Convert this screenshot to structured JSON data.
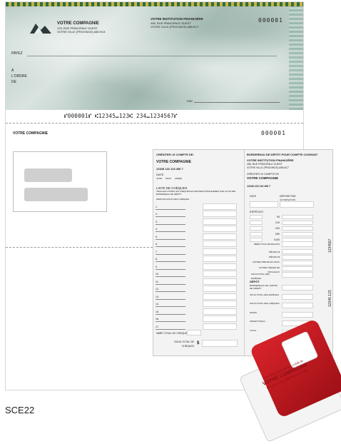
{
  "cheque": {
    "company": "VOTRE COMPAGNIE",
    "address_1": "123, RUE PRINCIPALE OUEST",
    "address_2": "VOTRE VILLE (PROVINCE) A5B 9C8",
    "institution": "VOTRE INSTITUTION FINANCIÈRE",
    "institution_addr_1": "456, RUE PRINCIPALE OUEST",
    "institution_addr_2": "VOTRE VILLE (PROVINCE) A5B 6C7",
    "number": "000001",
    "payez": "PAYEZ",
    "ordre": [
      "À",
      "L'ORDRE",
      "DE"
    ],
    "par": "PAR",
    "micr": "⑈000001⑈ ⑆12345⑉123⑆ 234⑉1234567⑈"
  },
  "stub": {
    "company": "VOTRE COMPAGNIE",
    "number": "000001"
  },
  "slip": {
    "left_title": "CRÉDITER LE COMPTE DE:",
    "left_company": "VOTRE COMPAGNIE",
    "account": "12345 123 123 456 7",
    "date_label": "DATE",
    "date_fields": [
      "JOUR",
      "MOIS",
      "ANNÉE"
    ],
    "cheques_list": "LISTE DE CHÈQUES",
    "cheques_note": "VEUILLEZ LISTER LES CHÈQUES EN DEVISES ÉTRANGÈRES SUR UN AUTRE BORDEREAU DE DÉPÔT",
    "identification": "IDENTIFICATION DES CHÈQUES",
    "rows": [
      "1.",
      "2.",
      "3.",
      "4.",
      "5.",
      "6.",
      "7.",
      "8.",
      "9.",
      "10.",
      "11.",
      "12.",
      "13.",
      "14.",
      "15.",
      "16.",
      "17."
    ],
    "nb_total": "NBRE TOTAL DE CHÈQUES",
    "sous_total": "SOUS-TOTAL DE CHÈQUES",
    "dollar": "$",
    "right_title": "BORDEREAU DE DÉPÔT POUR COMPTE COURANT",
    "right_institution": "VOTRE INSTITUTION FINANCIÈRE",
    "right_addr_1": "456, RUE PRINCIPALE OUEST",
    "right_addr_2": "VOTRE VILLE (PROVINCE) A5B 6C7",
    "crediter": "CRÉDITER LE COMPTE DE",
    "right_company": "VOTRE COMPAGNIE",
    "right_account": "12345 123 123 456 7",
    "depose_par": "DÉPOSÉ PAR",
    "autorisation": "AUTORISATION",
    "especes": "ESPÈCES",
    "denominations": [
      "X5",
      "X10",
      "X20",
      "X50",
      "X100"
    ],
    "nb_billets": "NBRE TOTAL DE BILLETS",
    "coins": [
      "PIÈCES 1$",
      "PIÈCES 2$"
    ],
    "autres_pieces": "AUTRES PIÈCES EN VRAC",
    "autres_roul": "AUTRES PIÈCES EN ROULEAUX",
    "sous_total_especes": "SOUS-TOTAL DES ESPÈCES",
    "depot": "DÉPÔT",
    "depot_rows": [
      "BORDEREAUX DE CARTES DE CRÉDIT",
      "SOUS-TOTAL DES ESPÈCES",
      "SOUS-TOTAL DES CHÈQUES",
      "MOINS",
      "ARGENT REÇU",
      "TOTAL"
    ],
    "side_numbers": [
      "1234567",
      "12345 123"
    ]
  },
  "stamp": {
    "lines": [
      "Pour dépôt seulement au crédit de",
      "VOTRE COMPAGNIE",
      "Nº 12345 123 COMPTE nº 123 456"
    ]
  },
  "product_code": "SCE22"
}
